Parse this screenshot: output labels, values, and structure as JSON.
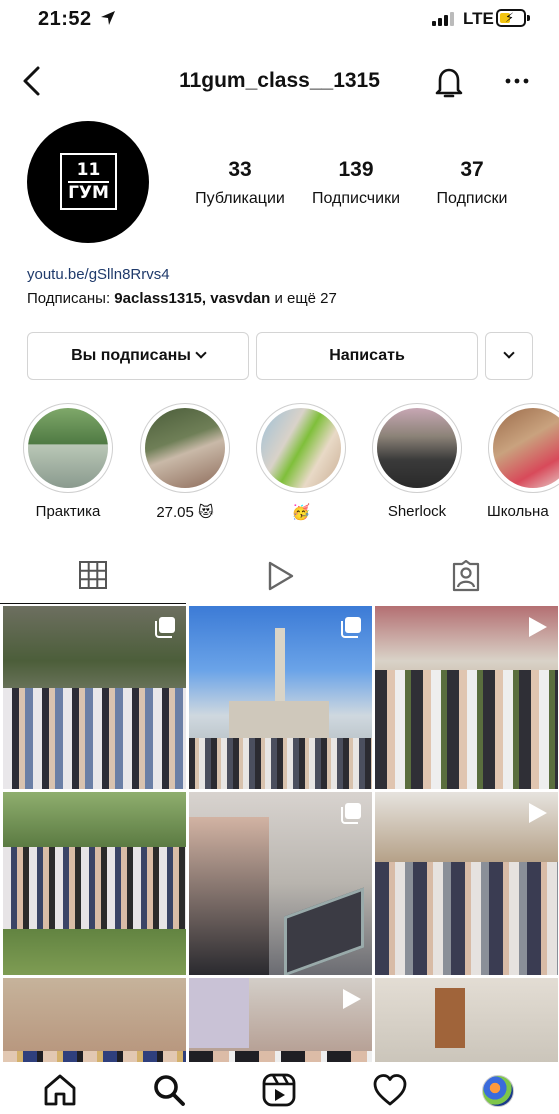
{
  "status_bar": {
    "time": "21:52",
    "network": "LTE"
  },
  "header": {
    "username": "11gum_class__1315"
  },
  "profile": {
    "avatar": {
      "line1": "11",
      "line2": "ГУМ"
    },
    "stats": [
      {
        "value": "33",
        "label": "Публикации"
      },
      {
        "value": "139",
        "label": "Подписчики"
      },
      {
        "value": "37",
        "label": "Подписки"
      }
    ],
    "link": "youtu.be/gSlln8Rrvs4",
    "followed_by_prefix": "Подписаны:",
    "followed_by_names": "9aclass1315, vasvdan",
    "followed_by_suffix": "и ещё 27"
  },
  "buttons": {
    "following": "Вы подписаны",
    "message": "Написать"
  },
  "highlights": [
    {
      "label": "Практика"
    },
    {
      "label": "27.05 😻"
    },
    {
      "label": "🥳"
    },
    {
      "label": "Sherlock"
    },
    {
      "label": "Школьна"
    }
  ],
  "tabs": [
    "grid-tab",
    "reels-tab",
    "tagged-tab"
  ],
  "posts": [
    {
      "kind": "carousel",
      "scene": "group-outdoor-rocks"
    },
    {
      "kind": "carousel",
      "scene": "tower-blue-sky"
    },
    {
      "kind": "video",
      "scene": "classroom-group"
    },
    {
      "kind": "none",
      "scene": "park-group"
    },
    {
      "kind": "carousel",
      "scene": "museum-screen"
    },
    {
      "kind": "video",
      "scene": "archive-room"
    },
    {
      "kind": "none",
      "scene": "audience"
    },
    {
      "kind": "video",
      "scene": "students-close"
    },
    {
      "kind": "none",
      "scene": "room-crowd"
    }
  ],
  "bottom_nav": [
    "home-icon",
    "search-icon",
    "reels-icon",
    "heart-icon",
    "profile-avatar"
  ]
}
